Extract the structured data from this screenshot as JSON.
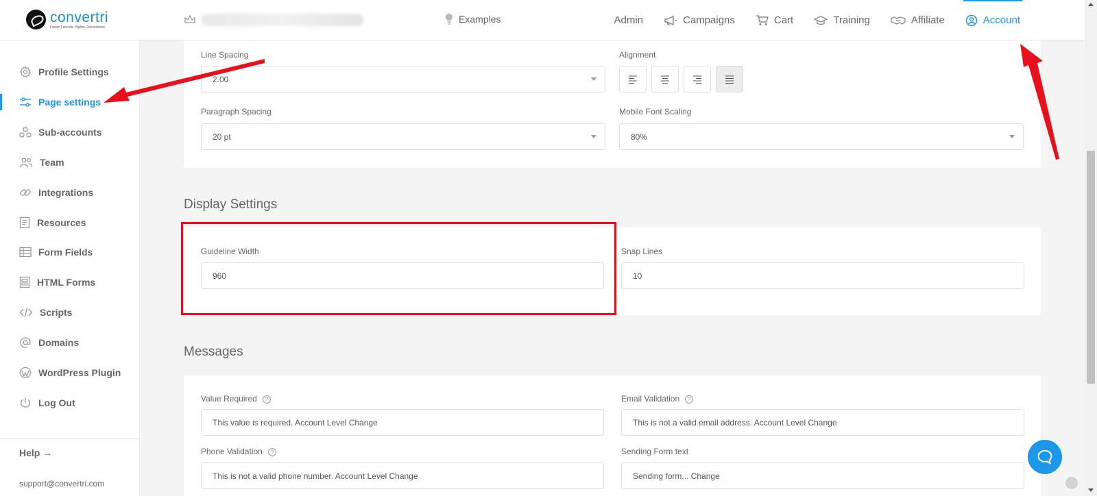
{
  "brand": {
    "name": "convertri",
    "tagline": "Faster Funnels, Higher Conversions"
  },
  "header": {
    "examples_label": "Examples",
    "nav": [
      {
        "label": "Admin",
        "icon": "none"
      },
      {
        "label": "Campaigns",
        "icon": "megaphone-icon"
      },
      {
        "label": "Cart",
        "icon": "cart-icon"
      },
      {
        "label": "Training",
        "icon": "graduation-cap-icon"
      },
      {
        "label": "Affiliate",
        "icon": "handshake-icon"
      },
      {
        "label": "Account",
        "icon": "user-circle-icon",
        "active": true
      }
    ]
  },
  "sidebar": {
    "items": [
      {
        "label": "Profile Settings",
        "icon": "gear-icon"
      },
      {
        "label": "Page settings",
        "icon": "sliders-icon",
        "active": true
      },
      {
        "label": "Sub-accounts",
        "icon": "sub-accounts-icon"
      },
      {
        "label": "Team",
        "icon": "team-icon"
      },
      {
        "label": "Integrations",
        "icon": "link-icon"
      },
      {
        "label": "Resources",
        "icon": "book-icon"
      },
      {
        "label": "Form Fields",
        "icon": "table-icon"
      },
      {
        "label": "HTML Forms",
        "icon": "form-icon"
      },
      {
        "label": "Scripts",
        "icon": "code-icon"
      },
      {
        "label": "Domains",
        "icon": "at-icon"
      },
      {
        "label": "WordPress Plugin",
        "icon": "wordpress-icon"
      },
      {
        "label": "Log Out",
        "icon": "power-icon"
      }
    ],
    "help_label": "Help →",
    "support_email": "support@convertri.com"
  },
  "typography": {
    "line_spacing_label": "Line Spacing",
    "line_spacing_value": "2.00",
    "alignment_label": "Alignment",
    "alignment_selected": "justify",
    "paragraph_spacing_label": "Paragraph Spacing",
    "paragraph_spacing_value": "20 pt",
    "mobile_font_scaling_label": "Mobile Font Scaling",
    "mobile_font_scaling_value": "80%"
  },
  "display_settings": {
    "title": "Display Settings",
    "guideline_width_label": "Guideline Width",
    "guideline_width_value": "960",
    "snap_lines_label": "Snap Lines",
    "snap_lines_value": "10"
  },
  "messages": {
    "title": "Messages",
    "value_required_label": "Value Required",
    "value_required_value": "This value is required. Account Level Change",
    "email_validation_label": "Email Validation",
    "email_validation_value": "This is not a valid email address. Account Level Change",
    "phone_validation_label": "Phone Validation",
    "phone_validation_value": "This is not a valid phone number. Account Level Change",
    "sending_form_label": "Sending Form text",
    "sending_form_value": "Sending form... Change"
  },
  "annotation_color": "#e8101b",
  "accent_color": "#1c96e6"
}
